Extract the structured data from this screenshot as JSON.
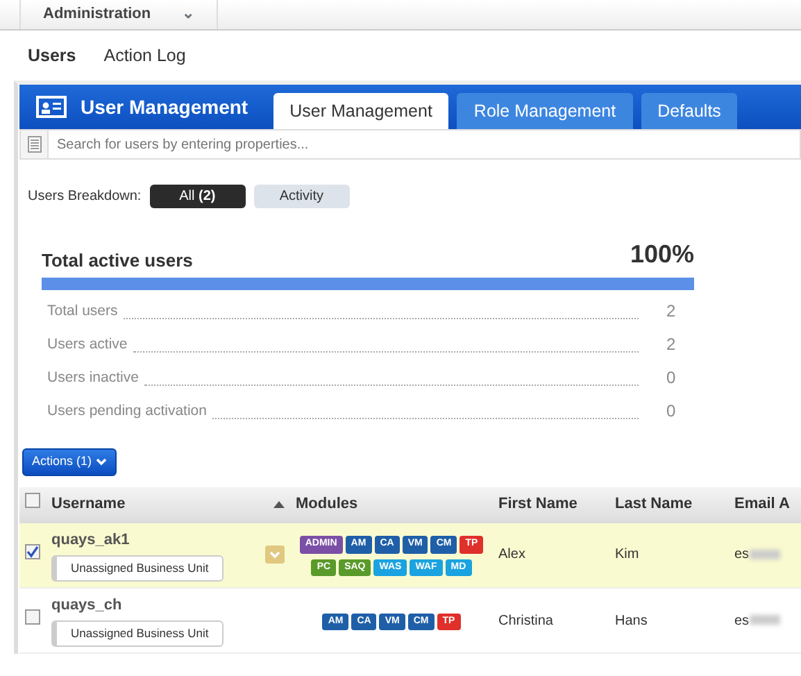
{
  "top_menu": {
    "label": "Administration",
    "chevron": "⌄"
  },
  "subnav": [
    {
      "label": "Users",
      "selected": true
    },
    {
      "label": "Action Log",
      "selected": false
    }
  ],
  "panel": {
    "title": "User Management",
    "tabs": [
      {
        "label": "User Management",
        "selected": true
      },
      {
        "label": "Role Management",
        "selected": false
      },
      {
        "label": "Defaults",
        "selected": false
      }
    ],
    "search": {
      "placeholder": "Search for users by entering properties..."
    }
  },
  "breakdown": {
    "label": "Users Breakdown:",
    "options": [
      {
        "label": "All",
        "count": "(2)",
        "selected": true
      },
      {
        "label": "Activity",
        "selected": false
      }
    ]
  },
  "stats": {
    "title": "Total active users",
    "percent": "100%",
    "level": 1,
    "rows": [
      {
        "label": "Total users",
        "value": "2"
      },
      {
        "label": "Users active",
        "value": "2"
      },
      {
        "label": "Users inactive",
        "value": "0"
      },
      {
        "label": "Users pending activation",
        "value": "0"
      }
    ]
  },
  "actions_button": "Actions (1)",
  "table": {
    "select_all_checked": false,
    "columns": [
      "Username",
      "Modules",
      "First Name",
      "Last Name",
      "Email A"
    ],
    "rows": [
      {
        "checked": true,
        "selected": true,
        "username": "quays_ak1",
        "business_unit": "Unassigned Business Unit",
        "expand": true,
        "modules": [
          [
            {
              "label": "ADMIN",
              "color": "#7b4fa6"
            },
            {
              "label": "AM",
              "color": "#1f5fa8"
            },
            {
              "label": "CA",
              "color": "#1f5fa8"
            },
            {
              "label": "VM",
              "color": "#1f5fa8"
            },
            {
              "label": "CM",
              "color": "#1f5fa8"
            },
            {
              "label": "TP",
              "color": "#e0302b"
            }
          ],
          [
            {
              "label": "PC",
              "color": "#5a9a2a"
            },
            {
              "label": "SAQ",
              "color": "#5a9a2a"
            },
            {
              "label": "WAS",
              "color": "#1aa3e0"
            },
            {
              "label": "WAF",
              "color": "#1aa3e0"
            },
            {
              "label": "MD",
              "color": "#1aa3e0"
            }
          ]
        ],
        "first_name": "Alex",
        "last_name": "Kim",
        "email": "es"
      },
      {
        "checked": false,
        "selected": false,
        "username": "quays_ch",
        "business_unit": "Unassigned Business Unit",
        "expand": false,
        "modules": [
          [
            {
              "label": "AM",
              "color": "#1f5fa8"
            },
            {
              "label": "CA",
              "color": "#1f5fa8"
            },
            {
              "label": "VM",
              "color": "#1f5fa8"
            },
            {
              "label": "CM",
              "color": "#1f5fa8"
            },
            {
              "label": "TP",
              "color": "#e0302b"
            }
          ]
        ],
        "first_name": "Christina",
        "last_name": "Hans",
        "email": "es"
      }
    ]
  }
}
